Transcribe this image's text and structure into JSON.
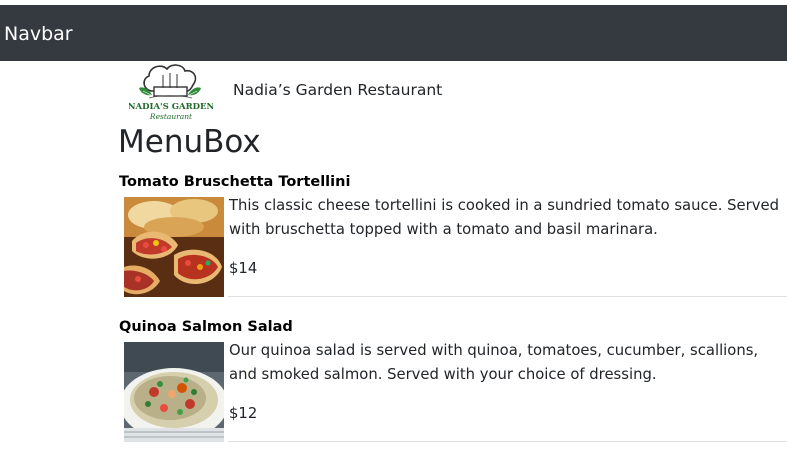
{
  "navbar": {
    "brand": "Navbar",
    "background": "#343a40"
  },
  "header": {
    "logo_icon": "chef-hat-logo",
    "logo_text_line1": "NADIA'S GARDEN",
    "logo_text_line2": "Restaurant",
    "restaurant_name": "Nadia’s Garden Restaurant"
  },
  "menu": {
    "title": "MenuBox",
    "items": [
      {
        "name": "Tomato Bruschetta Tortellini",
        "description": "This classic cheese tortellini is cooked in a sundried tomato sauce. Served with bruschetta topped with a tomato and basil marinara.",
        "price": "$14",
        "photo_icon": "bruschetta-photo"
      },
      {
        "name": "Quinoa Salmon Salad",
        "description": "Our quinoa salad is served with quinoa, tomatoes, cucumber, scallions, and smoked salmon. Served with your choice of dressing.",
        "price": "$12",
        "photo_icon": "salad-photo"
      }
    ]
  }
}
